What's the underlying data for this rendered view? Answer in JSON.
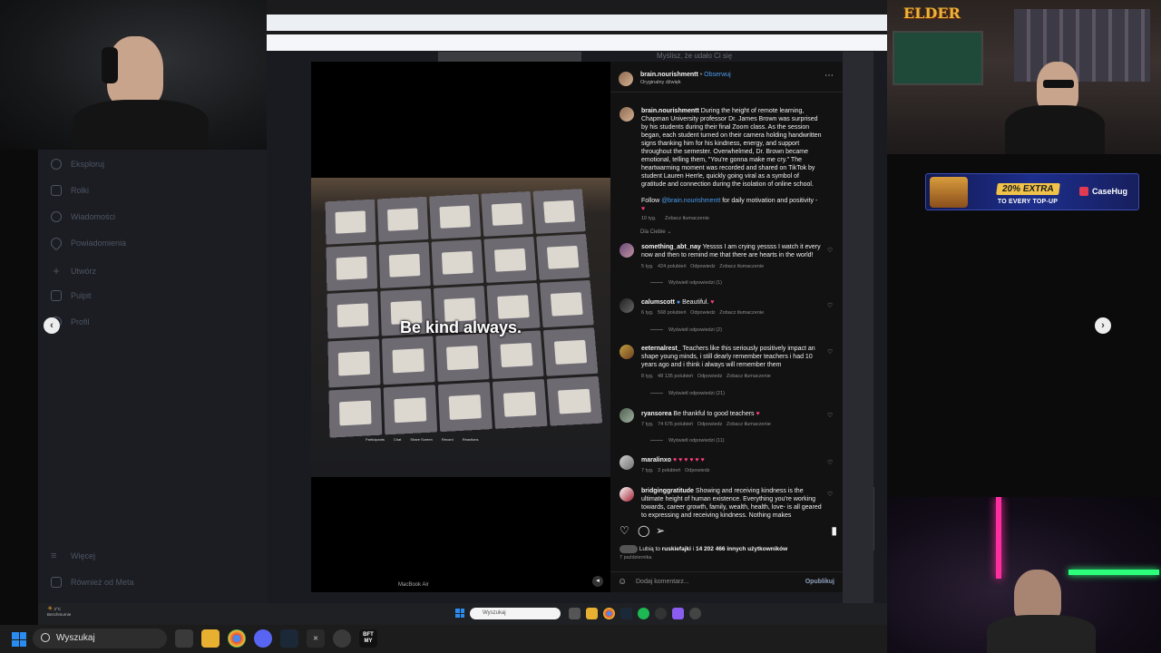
{
  "sidebar": {
    "items": [
      {
        "label": "Eksploruj",
        "icon": "compass-icon"
      },
      {
        "label": "Rolki",
        "icon": "reels-icon"
      },
      {
        "label": "Wiadomości",
        "icon": "messenger-icon"
      },
      {
        "label": "Powiadomienia",
        "icon": "heart-icon"
      },
      {
        "label": "Utwórz",
        "icon": "plus-icon"
      },
      {
        "label": "Pulpit",
        "icon": "dashboard-icon"
      },
      {
        "label": "Profil",
        "icon": "profile-icon"
      }
    ],
    "more_label": "Więcej",
    "also_meta_label": "Również od Meta"
  },
  "background_text": "Myślisz, że udało Ci się",
  "video": {
    "caption": "Be kind always.",
    "laptop_label": "MacBook Air",
    "zoom_bar": [
      "Participants",
      "Chat",
      "Share Screen",
      "Record",
      "Reactions"
    ]
  },
  "post": {
    "author": "brain.nourishmentt",
    "follow_label": "Obserwuj",
    "audio": "Oryginalny dźwięk",
    "caption_author": "brain.nourishmentt",
    "caption_text": "During the height of remote learning, Chapman University professor Dr. James Brown was surprised by his students during their final Zoom class. As the session began, each student turned on their camera holding handwritten signs thanking him for his kindness, energy, and support throughout the semester. Overwhelmed, Dr. Brown became emotional, telling them, \"You're gonna make me cry.\" The heartwarming moment was recorded and shared on TikTok by student Lauren Herrle, quickly going viral as a symbol of gratitude and connection during the isolation of online school.",
    "follow_prefix": "Follow",
    "follow_handle": "@brain.nourishmentt",
    "follow_suffix": "for daily motivation and positivity -",
    "caption_time": "10 tyg.",
    "see_translation": "Zobacz tłumaczenie",
    "for_you": "Dla Ciebie",
    "likes_prefix": "Lubią to",
    "likes_user": "ruskiefajki",
    "likes_mid": "i",
    "likes_count": "14 202 466 innych użytkowników",
    "date": "7 października",
    "comment_placeholder": "Dodaj komentarz...",
    "publish_label": "Opublikuj"
  },
  "comments": [
    {
      "user": "something_abt_nay",
      "text": "Yessss I am crying yessss I watch it every now and then to remind me that there are hearts in the world!",
      "time": "5 tyg.",
      "likes": "424 polubień",
      "reply": "Odpowiedz",
      "translate": "Zobacz tłumaczenie",
      "replies": "Wyświetl odpowiedzi (1)"
    },
    {
      "user": "calumscott",
      "text": "Beautiful.",
      "time": "6 tyg.",
      "likes": "568 polubień",
      "reply": "Odpowiedz",
      "translate": "Zobacz tłumaczenie",
      "replies": "Wyświetl odpowiedzi (2)"
    },
    {
      "user": "eeternalrest_",
      "text": "Teachers like this seriously positively impact an shape young minds, i still dearly remember teachers i had 10 years ago and i think i always will remember them",
      "time": "8 tyg.",
      "likes": "48 135 polubień",
      "reply": "Odpowiedz",
      "translate": "Zobacz tłumaczenie",
      "replies": "Wyświetl odpowiedzi (21)"
    },
    {
      "user": "ryansorea",
      "text": "Be thankful to good teachers",
      "time": "7 tyg.",
      "likes": "74 676 polubień",
      "reply": "Odpowiedz",
      "translate": "Zobacz tłumaczenie",
      "replies": "Wyświetl odpowiedzi (11)"
    },
    {
      "user": "maralinxo",
      "text": "♥ ♥ ♥ ♥ ♥ ♥",
      "time": "7 tyg.",
      "likes": "3 polubień",
      "reply": "Odpowiedz",
      "translate": "",
      "replies": ""
    },
    {
      "user": "bridginggratitude",
      "text": "Showing and receiving kindness is the ultimate height of human existence. Everything you're working towards, career growth, family, wealth, health, love- is all geared to expressing and receiving kindness. Nothing makes",
      "time": "",
      "likes": "",
      "reply": "",
      "translate": "",
      "replies": ""
    }
  ],
  "banner": {
    "big": "20% EXTRA",
    "small": "TO EVERY TOP-UP",
    "brand": "CaseHug"
  },
  "overlay_logo": "ELDER",
  "inner_taskbar": {
    "weather_temp": "2°C",
    "weather_desc": "Bezchmurnie",
    "search_placeholder": "Wyszukaj"
  },
  "taskbar": {
    "search_placeholder": "Wyszukaj",
    "app_label": "BFT MY"
  },
  "colors": {
    "accent_blue": "#4c9cf0",
    "heart_pink": "#ff3d7f",
    "promo_yellow": "#f0c24a",
    "windows_blue": "#2a8cf0"
  }
}
